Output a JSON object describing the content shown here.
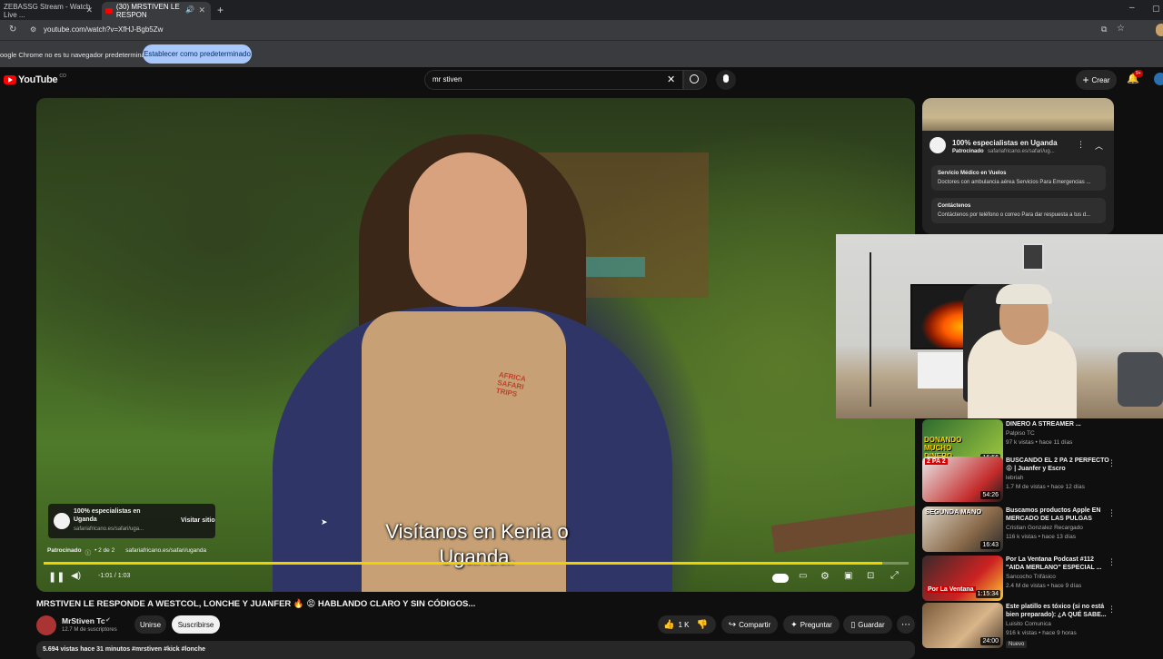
{
  "browser": {
    "tabs": [
      {
        "label": "ZEBASSG Stream - Watch Live ..."
      },
      {
        "label": "(30) MRSTIVEN LE RESPON"
      }
    ],
    "url": "youtube.com/watch?v=XfHJ-Bgb5Zw",
    "infobar": {
      "message": "oogle Chrome no es tu navegador predeterminado",
      "button": "Establecer como predeterminado"
    }
  },
  "header": {
    "logo": "YouTube",
    "logo_country": "CO",
    "search_value": "mr stiven",
    "create_label": "Crear",
    "notif_badge": "9+"
  },
  "player": {
    "subtitle_line1": "Visítanos en Kenia o",
    "subtitle_line2": "Uganda.",
    "ad_title": "100% especialistas en Uganda",
    "ad_domain": "safariafricano.es/safari/uga...",
    "ad_visit": "Visitar sitio",
    "ad_sponsored": "Patrocinado",
    "ad_count": "• 2 de 2",
    "ad_url": "safariafricano.es/safari/uganda",
    "time": "-1:01 / 1:03",
    "progress": 0.97
  },
  "video": {
    "title": "MRSTIVEN LE RESPONDE A WESTCOL, LONCHE Y JUANFER 🔥 😡 HABLANDO CLARO Y SIN CÓDIGOS...",
    "channel": "MrStiven Tc",
    "subscribers": "12.7 M de suscriptores",
    "join": "Unirse",
    "subscribe": "Suscribirse",
    "likes": "1 K",
    "share": "Compartir",
    "ask": "Preguntar",
    "save": "Guardar",
    "meta": "5.694 vistas  hace 31 minutos  #mrstiven #kick #lonche"
  },
  "sidebar_ad": {
    "title": "100% especialistas en Uganda",
    "sponsor": "Patrocinado",
    "domain": "safariafricano.es/safari/ug...",
    "links": [
      {
        "title": "Servicio Médico en Vuelos",
        "desc": "Doctores con ambulancia aérea Servicios Para Emergencias ..."
      },
      {
        "title": "Contáctenos",
        "desc": "Contáctenos por teléfono o correo Para dar respuesta a tus d..."
      }
    ]
  },
  "recommendations": [
    {
      "title": "DINERO A STREAMER ...",
      "channel": "Palpiso TC",
      "meta": "97 k vistas • hace 11 días",
      "duration": "16:56",
      "thumb_text": "DONANDO MUCHO DINERO"
    },
    {
      "title": "BUSCANDO EL 2 PA 2 PERFECTO 😡 | Juanfer y Escro",
      "channel": "lebriah",
      "meta": "1.7 M de vistas • hace 12 días",
      "duration": "54:26",
      "thumb_text": "2 PA 2"
    },
    {
      "title": "Buscamos productos Apple EN MERCADO DE LAS PULGAS",
      "channel": "Cristian Gonzalez Recargado",
      "meta": "116 k vistas • hace 13 días",
      "duration": "16:43",
      "thumb_text": "SEGUNDA MANO"
    },
    {
      "title": "Por La Ventana Podcast #112 \"AIDA MERLANO\" ESPECIAL ...",
      "channel": "Sancocho Trifásico",
      "meta": "2.4 M de vistas • hace 9 días",
      "duration": "1:15:34",
      "thumb_text": "Por La Ventana"
    },
    {
      "title": "Este platillo es tóxico (si no está bien preparado): ¿A QUÉ SABE...",
      "channel": "Luisito Comunica",
      "meta": "916 k vistas • hace 9 horas",
      "duration": "24:00",
      "badge": "Nuevo"
    }
  ]
}
